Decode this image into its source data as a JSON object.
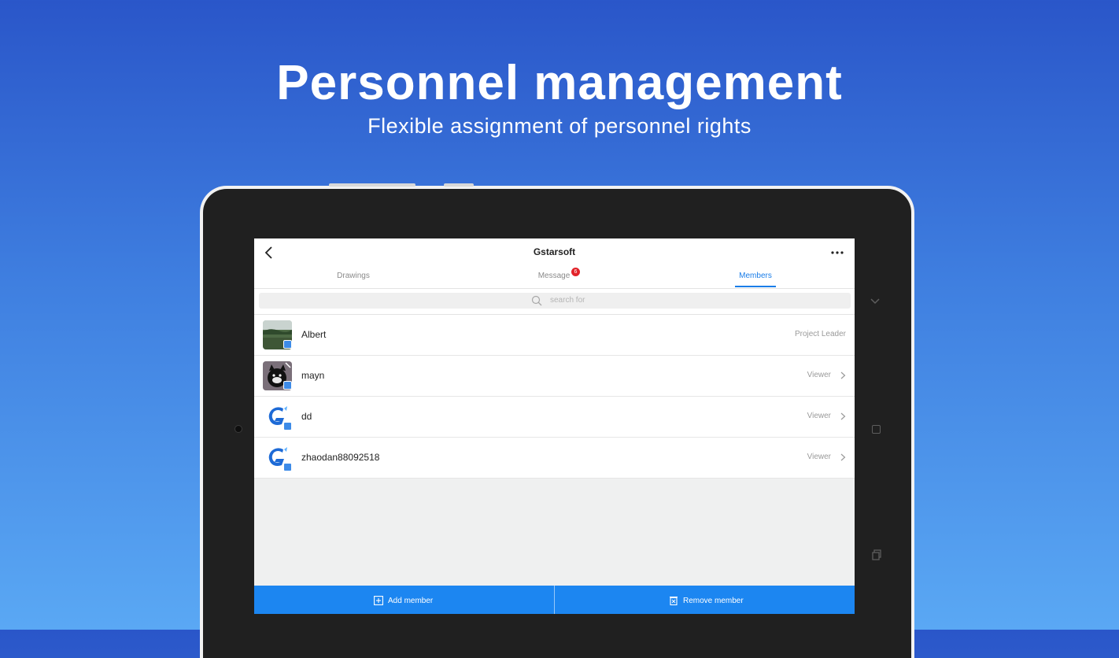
{
  "hero": {
    "title": "Personnel management",
    "subtitle": "Flexible assignment of personnel rights"
  },
  "app": {
    "title": "Gstarsoft",
    "tabs": [
      {
        "label": "Drawings",
        "active": false
      },
      {
        "label": "Message",
        "active": false,
        "badge": "6"
      },
      {
        "label": "Members",
        "active": true
      }
    ],
    "search": {
      "placeholder": "search for"
    },
    "members": [
      {
        "name": "Albert",
        "role": "Project Leader",
        "avatar": "landscape-photo"
      },
      {
        "name": "mayn",
        "role": "Viewer",
        "avatar": "cat-cartoon"
      },
      {
        "name": "dd",
        "role": "Viewer",
        "avatar": "gstarcad-logo"
      },
      {
        "name": "zhaodan88092518",
        "role": "Viewer",
        "avatar": "gstarcad-logo"
      }
    ],
    "actions": {
      "add_member": "Add member",
      "remove_member": "Remove member"
    }
  },
  "colors": {
    "accent": "#1a7de8",
    "bottom_bar": "#1c86f1",
    "badge": "#e2232a"
  }
}
